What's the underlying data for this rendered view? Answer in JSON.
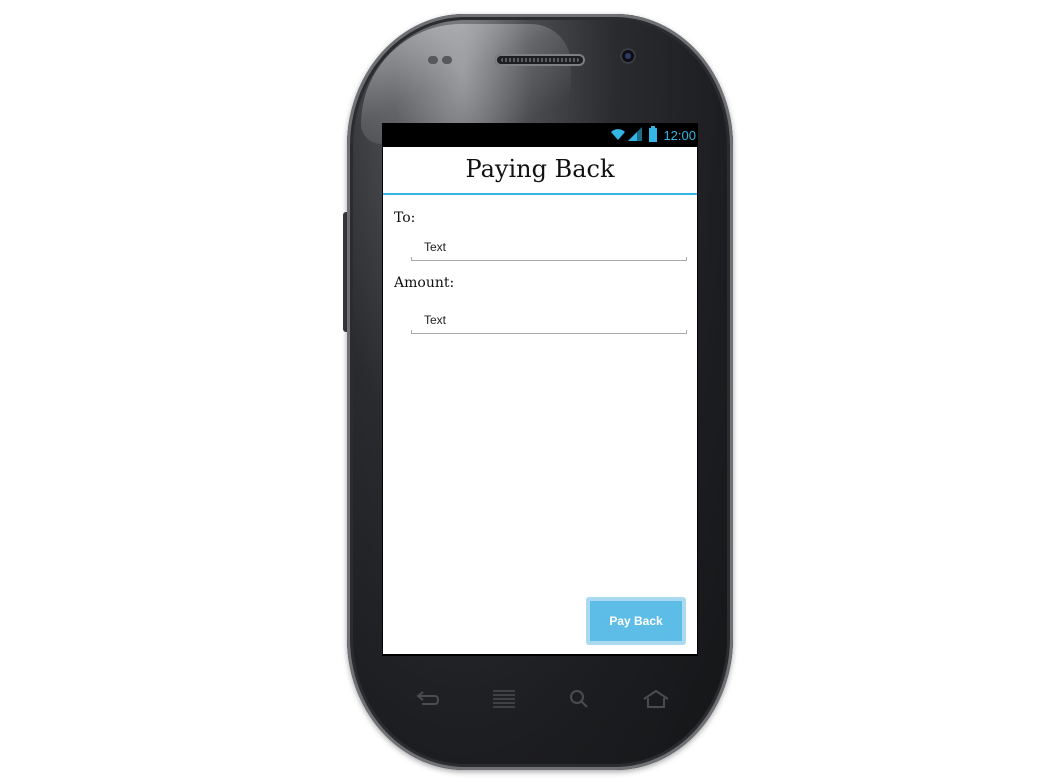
{
  "statusbar": {
    "time": "12:00",
    "icons": [
      "wifi-icon",
      "signal-icon",
      "battery-icon"
    ],
    "accent_color": "#33b5e5"
  },
  "app": {
    "title": "Paying Back",
    "to_label": "To:",
    "to_field": {
      "value": "Text"
    },
    "amount_label": "Amount:",
    "amount_field": {
      "value": "Text"
    },
    "pay_button_label": "Pay Back",
    "button_color": "#5dbde6"
  },
  "hardware_keys": [
    "back-icon",
    "menu-icon",
    "search-icon",
    "home-icon"
  ]
}
